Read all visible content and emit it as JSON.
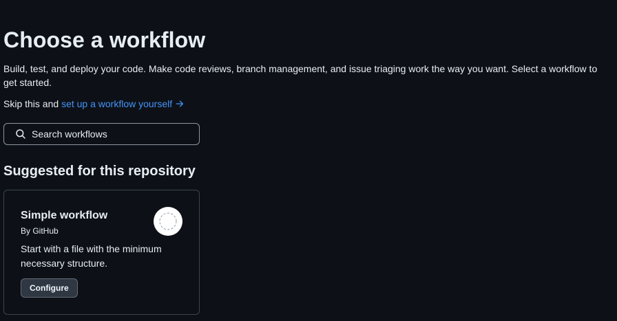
{
  "header": {
    "title": "Choose a workflow",
    "description": "Build, test, and deploy your code. Make code reviews, branch management, and issue triaging work the way you want. Select a workflow to get started.",
    "skip_prefix": "Skip this and ",
    "skip_link": "set up a workflow yourself"
  },
  "search": {
    "placeholder": "Search workflows",
    "value": ""
  },
  "suggested": {
    "section_title": "Suggested for this repository",
    "cards": [
      {
        "title": "Simple workflow",
        "author": "By GitHub",
        "description": "Start with a file with the minimum necessary structure.",
        "button_label": "Configure",
        "icon": "dashed-circle-icon"
      }
    ]
  },
  "colors": {
    "background": "#0d1117",
    "text": "#e6edf3",
    "link": "#4493f8",
    "border": "#3d444d",
    "button_bg": "#2f3742"
  }
}
